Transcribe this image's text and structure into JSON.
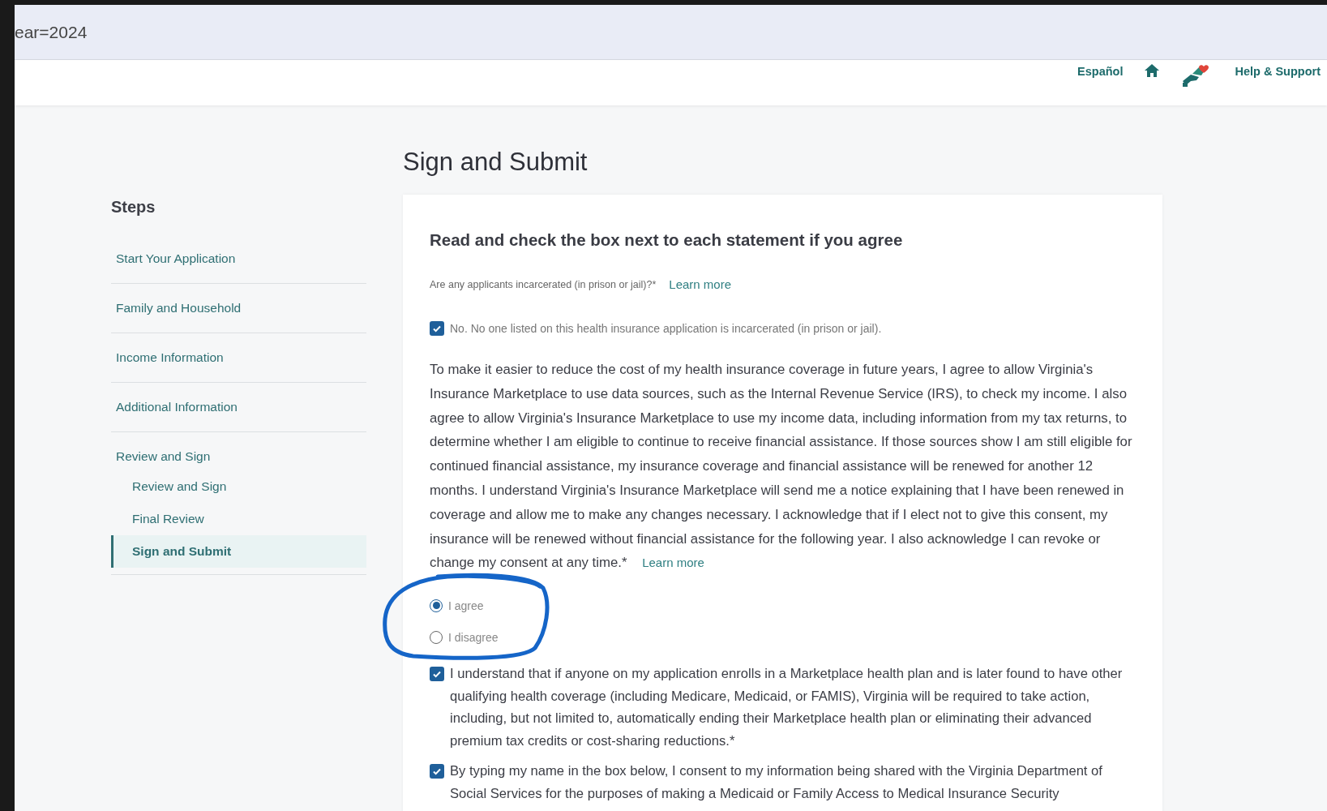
{
  "address_bar": {
    "text": "ear=2024"
  },
  "header": {
    "language_link": "Español",
    "help_link": "Help & Support"
  },
  "sidebar": {
    "title": "Steps",
    "steps": [
      {
        "label": "Start Your Application",
        "selected": false
      },
      {
        "label": "Family and Household",
        "selected": false
      },
      {
        "label": "Income Information",
        "selected": false
      },
      {
        "label": "Additional Information",
        "selected": false
      },
      {
        "label": "Review and Sign",
        "selected": false,
        "children": [
          {
            "label": "Review and Sign",
            "selected": false
          },
          {
            "label": "Final Review",
            "selected": false
          },
          {
            "label": "Sign and Submit",
            "selected": true
          }
        ]
      }
    ]
  },
  "main": {
    "title": "Sign and Submit",
    "card": {
      "heading": "Read and check the box next to each statement if you agree",
      "question": {
        "label": "Are any applicants incarcerated (in prison or jail)?*",
        "link": "Learn more"
      },
      "incarceration_option": {
        "label": "No. No one listed on this health insurance application is incarcerated (in prison or jail).",
        "checked": true
      },
      "consent": {
        "text": "To make it easier to reduce the cost of my health insurance coverage in future years, I agree to allow Virginia's Insurance Marketplace to use data sources, such as the Internal Revenue Service (IRS), to check my income. I also agree to allow Virginia's Insurance Marketplace to use my income data, including information from my tax returns, to determine whether I am eligible to continue to receive financial assistance. If those sources show I am still eligible for continued financial assistance, my insurance coverage and financial assistance will be renewed for another 12 months. I understand Virginia's Insurance Marketplace will send me a notice explaining that I have been renewed in coverage and allow me to make any changes necessary. I acknowledge that if I elect not to give this consent, my insurance will be renewed without financial assistance for the following year. I also acknowledge I can revoke or change my consent at any time.*",
        "link": "Learn more",
        "options": [
          {
            "label": "I agree",
            "selected": true
          },
          {
            "label": "I disagree",
            "selected": false
          }
        ]
      },
      "statements": [
        {
          "text": "I understand that if anyone on my application enrolls in a Marketplace health plan and is later found to have other qualifying health coverage (including Medicare, Medicaid, or FAMIS), Virginia will be required to take action, including, but not limited to, automatically ending their Marketplace health plan or eliminating their advanced premium tax credits or cost-sharing reductions.*",
          "checked": true
        },
        {
          "text": "By typing my name in the box below, I consent to my information being shared with the Virginia Department of Social Services for the purposes of making a Medicaid or Family Access to Medical Insurance Security",
          "checked": true
        }
      ]
    }
  }
}
